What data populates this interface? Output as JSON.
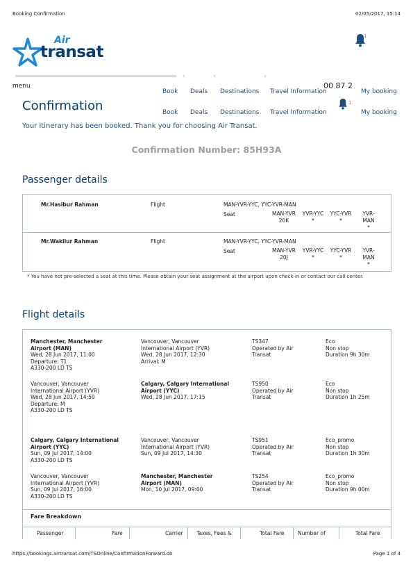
{
  "print_header": {
    "title": "Booking Confirmation",
    "datetime": "02/05/2017, 15:14"
  },
  "logo": {
    "top": "Air",
    "bottom": "transat"
  },
  "notifications": {
    "count": "1"
  },
  "nav": {
    "menu": "menu",
    "items": [
      "Book",
      "Deals",
      "Destinations",
      "Travel Information"
    ],
    "phone_fragment": "00 87 2",
    "my_booking": "My booking",
    "items2": [
      "Book",
      "Deals",
      "Destinations",
      "Travel Information"
    ],
    "notif2": "1",
    "my_booking2": "My booking"
  },
  "page": {
    "title": "Confirmation",
    "subtitle": "Your itinerary has been booked. Thank you for choosing Air Transat.",
    "conf_label": "Confirmation Number: 85H93A"
  },
  "passengers": {
    "title": "Passenger details",
    "rows": [
      {
        "name": "Mr.Hasibur Rahman",
        "type": "Flight",
        "route": "MAN-YVR-YYC, YYC-YVR-MAN",
        "seat_label": "Seat",
        "legs": [
          "MAN-YVR",
          "YVR-YYC",
          "YYC-YVR",
          "YVR-MAN"
        ],
        "seats": [
          "20K",
          "*",
          "*",
          "*"
        ]
      },
      {
        "name": "Mr.Wakilur Rahman",
        "type": "Flight",
        "route": "MAN-YVR-YYC, YYC-YVR-MAN",
        "seat_label": "Seat",
        "legs": [
          "MAN-YVR",
          "YVR-YYC",
          "YYC-YVR",
          "YVR-MAN"
        ],
        "seats": [
          "20J",
          "*",
          "*",
          "*"
        ]
      }
    ],
    "note": "* You have not pre-selected a seat at this time. Please obtain your seat assignment at the airport upon check-in or contact our call center."
  },
  "flights": {
    "title": "Flight details",
    "legs": [
      {
        "from_bold": "Manchester, Manchester Airport (MAN)",
        "from_date": "Wed, 28 Jun 2017, 11:00",
        "from_extra": "Departure: T1",
        "aircraft": "A330-200 LD TS",
        "to": "Vancouver, Vancouver International Airport (YVR)",
        "to_date": "Wed, 28 Jun 2017, 12:30",
        "to_extra": "Arrival: M",
        "flight": "TS347",
        "operated": "Operated by Air Transat",
        "cabin": "Eco",
        "stops": "Non stop",
        "duration": "Duration 9h 30m"
      },
      {
        "from": "Vancouver, Vancouver International Airport (YVR)",
        "from_date": "Wed, 28 Jun 2017, 14:50",
        "from_extra": "Departure: M",
        "aircraft": "A330-200 LD TS",
        "to_bold": "Calgary, Calgary International Airport (YYC)",
        "to_date": "Wed, 28 Jun 2017, 17:15",
        "flight": "TS950",
        "operated": "Operated by Air Transat",
        "cabin": "Eco",
        "stops": "Non stop",
        "duration": "Duration 1h 25m"
      },
      {
        "from_bold": "Calgary, Calgary International Airport (YYC)",
        "from_date": "Sun, 09 Jul 2017, 14:00",
        "aircraft": "A330-200 LD TS",
        "to": "Vancouver, Vancouver International Airport (YVR)",
        "to_date": "Sun, 09 Jul 2017, 14:30",
        "flight": "TS951",
        "operated": "Operated by Air Transat",
        "cabin": "Eco_promo",
        "stops": "Non stop",
        "duration": "Duration 1h 30m"
      },
      {
        "from": "Vancouver, Vancouver International Airport (YVR)",
        "from_date": "Sun, 09 Jul 2017, 16:00",
        "aircraft": "A330-200 LD TS",
        "to_bold": "Manchester, Manchester Airport (MAN)",
        "to_date": "Mon, 10 Jul 2017, 09:00",
        "flight": "TS254",
        "operated": "Operated by Air Transat",
        "cabin": "Eco_promo",
        "stops": "Non stop",
        "duration": "Duration 9h 00m"
      }
    ]
  },
  "fare": {
    "title": "Fare Breakdown",
    "headers": [
      "Passenger",
      "Fare",
      "Carrier",
      "Taxes, Fees &",
      "Total Fare",
      "Number of",
      "Total Fare"
    ]
  },
  "print_footer": {
    "url": "https://bookings.airtransat.com/TSOnline/ConfirmationForward.do",
    "page": "Page 1 of 4"
  },
  "colors": {
    "brand": "#0a3e73",
    "accent": "#1e8ad6",
    "border": "#aab9c7"
  }
}
